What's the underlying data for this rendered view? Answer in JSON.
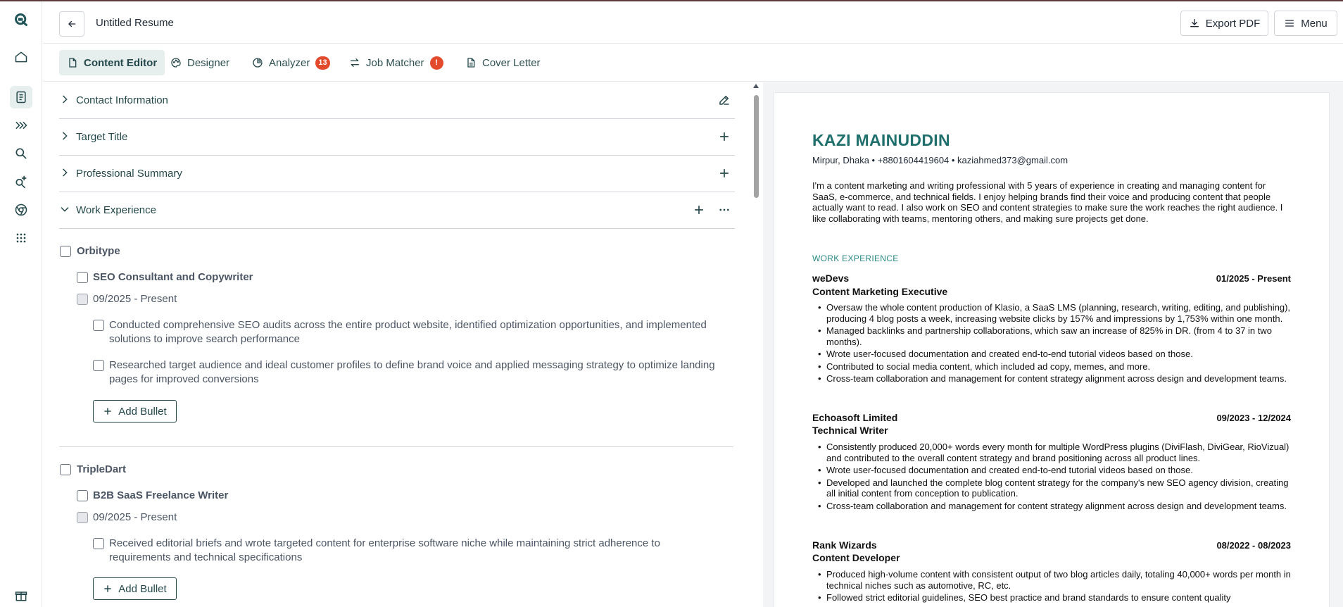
{
  "header": {
    "title": "Untitled Resume",
    "export_label": "Export PDF",
    "menu_label": "Menu"
  },
  "tabs": [
    {
      "label": "Content Editor",
      "active": true
    },
    {
      "label": "Designer"
    },
    {
      "label": "Analyzer",
      "badge": "13"
    },
    {
      "label": "Job Matcher",
      "badge": "!"
    },
    {
      "label": "Cover Letter"
    }
  ],
  "sidebar": {
    "icons": [
      "logo-icon",
      "home-icon",
      "resume-icon",
      "chevrons-right-icon",
      "search-icon",
      "ai-search-icon",
      "chrome-icon",
      "apps-grid-icon",
      "gift-icon"
    ]
  },
  "editor": {
    "sections": [
      {
        "label": "Contact Information",
        "action": "edit-icon"
      },
      {
        "label": "Target Title",
        "action": "plus-icon"
      },
      {
        "label": "Professional Summary",
        "action": "plus-icon"
      },
      {
        "label": "Work Experience",
        "action": "plus-icon",
        "expanded": true
      }
    ],
    "add_bullet_label": "Add Bullet",
    "jobs": [
      {
        "company": "Orbitype",
        "role": "SEO Consultant and Copywriter",
        "dates": "09/2025 - Present",
        "bullets": [
          "Conducted comprehensive SEO audits across the entire product website, identified optimization opportunities, and implemented solutions to improve search performance",
          "Researched target audience and ideal customer profiles to define brand voice and applied messaging strategy to optimize landing pages for improved conversions"
        ]
      },
      {
        "company": "TripleDart",
        "role": "B2B SaaS Freelance Writer",
        "dates": "09/2025 - Present",
        "bullets": [
          "Received editorial briefs and wrote targeted content for enterprise software niche while maintaining strict adherence to requirements and technical specifications"
        ]
      }
    ]
  },
  "preview": {
    "name": "KAZI MAINUDDIN",
    "contact": "Mirpur, Dhaka • +8801604419604 • kaziahmed373@gmail.com",
    "summary": "I'm a content marketing and writing professional with 5 years of experience in creating and managing content for SaaS, e-commerce, and technical fields. I enjoy helping brands find their voice and producing content that people actually want to read. I also work on SEO and content strategies to make sure the work reaches the right audience. I like collaborating with teams, mentoring others, and making sure projects get done.",
    "section_title": "WORK EXPERIENCE",
    "jobs": [
      {
        "company": "weDevs",
        "dates": "01/2025 - Present",
        "role": "Content Marketing Executive",
        "bullets": [
          "Oversaw the whole content production of Klasio, a SaaS LMS (planning, research, writing, editing, and publishing), producing 4 blog posts a week, increasing website clicks by 157% and impressions by 1,753% within one month.",
          "Managed backlinks and partnership collaborations, which saw an increase of 825% in DR. (from 4 to 37 in two months).",
          "Wrote user-focused documentation and created end-to-end tutorial videos based on those.",
          "Contributed to social media content, which included ad copy, memes, and more.",
          "Cross-team collaboration and management for content strategy alignment across design and development teams."
        ]
      },
      {
        "company": "Echoasoft Limited",
        "dates": "09/2023 - 12/2024",
        "role": "Technical Writer",
        "bullets": [
          "Consistently produced 20,000+ words every month for multiple WordPress plugins (DiviFlash, DiviGear, RioVizual) and contributed to the overall content strategy and brand positioning across all product lines.",
          "Wrote user-focused documentation and created end-to-end tutorial videos based on those.",
          "Developed and launched the complete blog content strategy for the company's new SEO agency division, creating all initial content from conception to publication.",
          "Cross-team collaboration and management for content strategy alignment across design and development teams."
        ]
      },
      {
        "company": "Rank Wizards",
        "dates": "08/2022 - 08/2023",
        "role": "Content Developer",
        "bullets": [
          "Produced high-volume content with consistent output of two blog articles daily, totaling 40,000+ words per month in technical niches such as automotive, RC, etc.",
          "Followed strict editorial guidelines, SEO best practice and brand standards to ensure content quality"
        ]
      }
    ]
  },
  "colors": {
    "brand": "#24484a",
    "preview_accent": "#1f6f6c",
    "badge": "#e24a2b",
    "active_tab_bg": "#e6eeee"
  }
}
